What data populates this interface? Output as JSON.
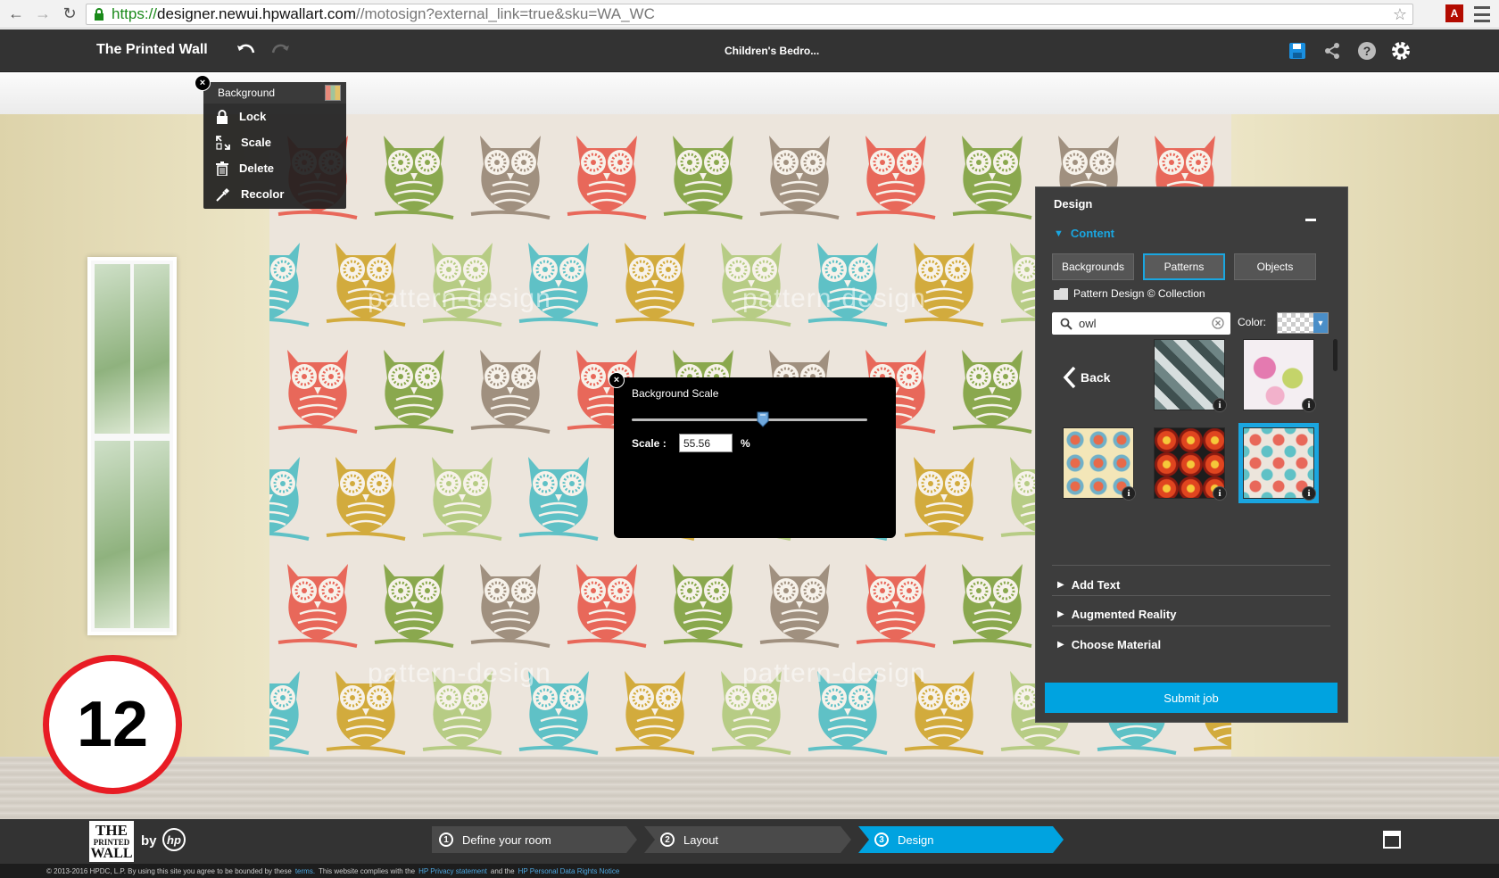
{
  "browser": {
    "url_scheme": "https://",
    "url_host": "designer.newui.hpwallart.com",
    "url_path": "//motosign?external_link=true&sku=WA_WC"
  },
  "header": {
    "app_title": "The Printed Wall",
    "project_name": "Children's Bedro..."
  },
  "context_menu": {
    "title": "Background",
    "items": [
      {
        "label": "Lock",
        "icon": "lock-icon"
      },
      {
        "label": "Scale",
        "icon": "scale-icon"
      },
      {
        "label": "Delete",
        "icon": "trash-icon"
      },
      {
        "label": "Recolor",
        "icon": "eyedropper-icon"
      }
    ]
  },
  "scale_dialog": {
    "title": "Background Scale",
    "scale_label": "Scale :",
    "value": "55.56",
    "unit": "%",
    "slider_fraction": 0.5556
  },
  "wall": {
    "watermark": "pattern-design"
  },
  "design_panel": {
    "title": "Design",
    "content_label": "Content",
    "tabs": [
      "Backgrounds",
      "Patterns",
      "Objects"
    ],
    "active_tab": "Patterns",
    "collection": "Pattern Design © Collection",
    "search_value": "owl",
    "color_label": "Color:",
    "back_label": "Back",
    "info_glyph": "i",
    "accordion": [
      "Add Text",
      "Augmented Reality",
      "Choose Material"
    ],
    "submit_label": "Submit job"
  },
  "step_badge": "12",
  "bottom_bar": {
    "logo_text_1": "THE",
    "logo_text_2": "PRINTED",
    "logo_text_3": "WALL",
    "by_text": "by",
    "hp_text": "hp",
    "steps": [
      {
        "num": "1",
        "label": "Define your room"
      },
      {
        "num": "2",
        "label": "Layout"
      },
      {
        "num": "3",
        "label": "Design"
      }
    ],
    "active_step": "Design"
  },
  "footer": {
    "text_1": "© 2013-2016 HPDC, L.P.  By using this site you agree to be bounded by these",
    "link_terms": "terms.",
    "text_2": "This website complies with the",
    "link_privacy": "HP Privacy statement",
    "text_3": "and the",
    "link_rights": "HP Personal Data Rights Notice"
  },
  "colors": {
    "accent": "#1aa6e0",
    "submit": "#00a3e0",
    "badge_ring": "#e81c24",
    "owl_red": "#e8685a",
    "owl_teal": "#5fc1c6",
    "owl_green": "#8aa84e",
    "owl_mustard": "#d2ab3d",
    "owl_taupe": "#a0907f",
    "owl_lime": "#b7cc85"
  }
}
